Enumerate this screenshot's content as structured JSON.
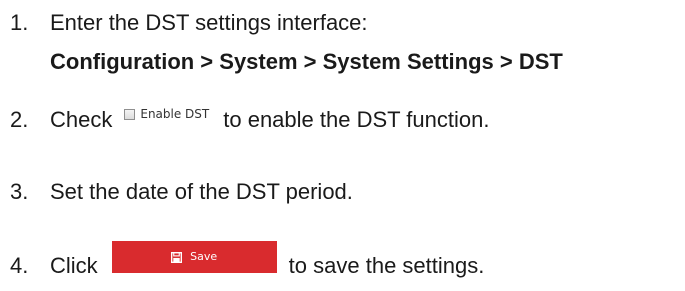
{
  "steps": [
    {
      "num": "1.",
      "text": "Enter the DST settings interface:"
    },
    {
      "num": "2.",
      "before": "Check",
      "after": "to enable the DST function."
    },
    {
      "num": "3.",
      "text": "Set the date of the DST period."
    },
    {
      "num": "4.",
      "before": "Click",
      "after": "to save the settings."
    }
  ],
  "path": "Configuration > System > System Settings > DST",
  "checkbox": {
    "label": "Enable DST",
    "checked": false
  },
  "save_button": {
    "label": "Save",
    "icon": "save-icon",
    "color": "#d92b2e"
  }
}
